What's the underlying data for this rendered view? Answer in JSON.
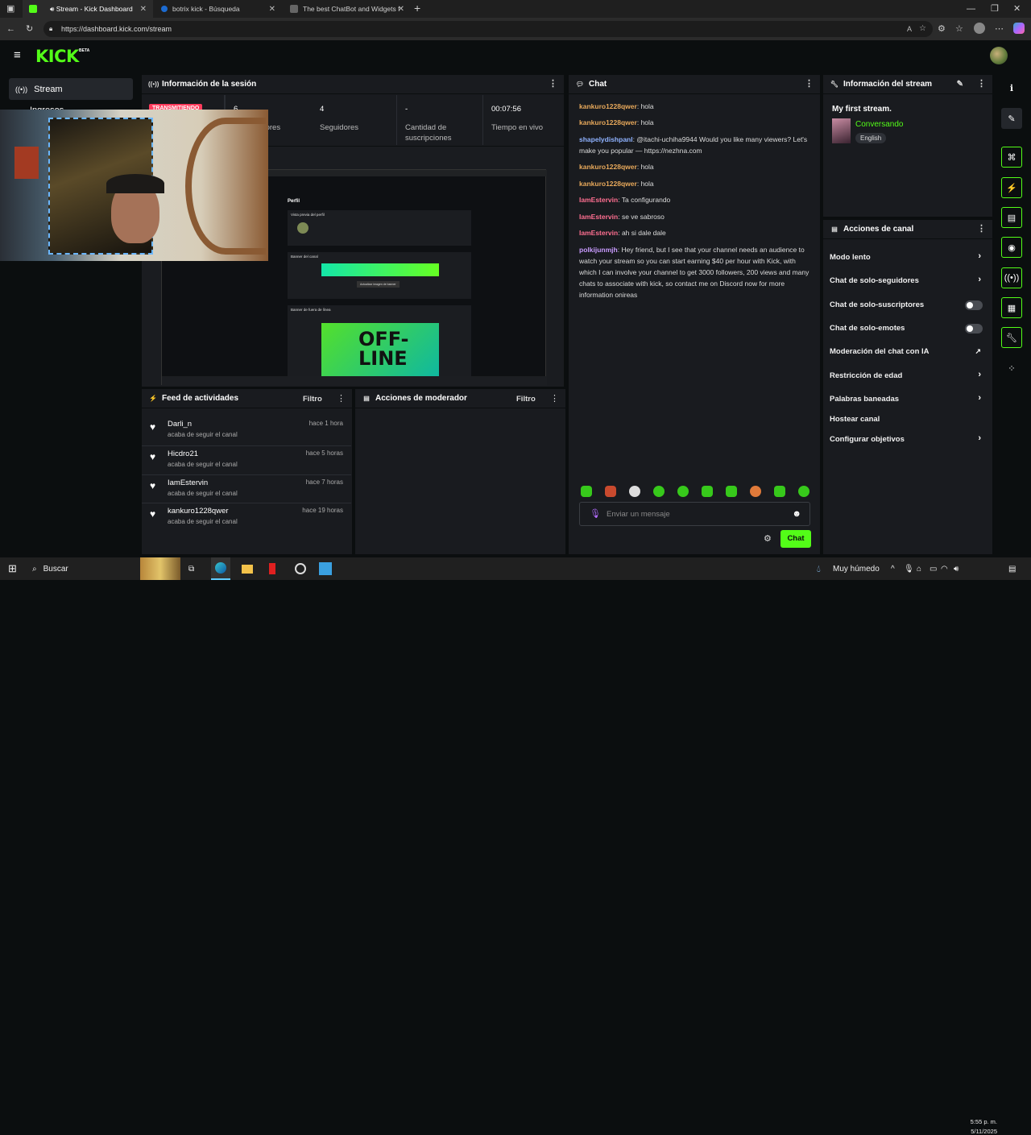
{
  "browser": {
    "tabs": [
      {
        "title": "Stream - Kick Dashboard",
        "active": true
      },
      {
        "title": "botrix kick - Búsqueda",
        "active": false
      },
      {
        "title": "The best ChatBot and Widgets fo",
        "active": false
      }
    ],
    "url": "https://dashboard.kick.com/stream"
  },
  "header": {
    "logo": "KICK",
    "beta": "BETA"
  },
  "nav": {
    "stream_label": "Stream",
    "partial_label": "Ingresos"
  },
  "session": {
    "title": "Información de la sesión",
    "live_badge": "TRANSMITIENDO",
    "stats": [
      {
        "value": "6",
        "label": "Espectadores"
      },
      {
        "value": "4",
        "label": "Seguidores"
      },
      {
        "value": "-",
        "label": "Cantidad de suscripciones"
      },
      {
        "value": "00:07:56",
        "label": "Tiempo en vivo"
      }
    ]
  },
  "preview": {
    "profile_heading": "Perfil",
    "profile_preview": "Vista previa del perfil",
    "banner_label": "Banner del canal",
    "offline_banner_label": "Banner de fuera de línea",
    "offline_text": "OFF- LINE",
    "update_btn": "Actualizar imagen de banner"
  },
  "feed": {
    "title": "Feed de actividades",
    "filter": "Filtro",
    "items": [
      {
        "name": "Darli_n",
        "sub": "acaba de seguir el canal",
        "time": "hace 1 hora"
      },
      {
        "name": "Hicdro21",
        "sub": "acaba de seguir el canal",
        "time": "hace 5 horas"
      },
      {
        "name": "IamEstervin",
        "sub": "acaba de seguir el canal",
        "time": "hace 7 horas"
      },
      {
        "name": "kankuro1228qwer",
        "sub": "acaba de seguir el canal",
        "time": "hace 19 horas"
      }
    ]
  },
  "moderator": {
    "title": "Acciones de moderador",
    "filter": "Filtro"
  },
  "chat": {
    "title": "Chat",
    "messages": [
      {
        "user": "kankuro1228qwer",
        "color": "#e8a95b",
        "text": "hola"
      },
      {
        "user": "kankuro1228qwer",
        "color": "#e8a95b",
        "text": "hola"
      },
      {
        "user": "shapelydishpanl",
        "color": "#8fb2ff",
        "text": "@itachi-uchiha9944 Would you like many viewers? Let's make you popular — https://nezhna.com"
      },
      {
        "user": "kankuro1228qwer",
        "color": "#e8a95b",
        "text": "hola"
      },
      {
        "user": "kankuro1228qwer",
        "color": "#e8a95b",
        "text": "hola"
      },
      {
        "user": "IamEstervin",
        "color": "#ff6f91",
        "text": "Ta configurando"
      },
      {
        "user": "IamEstervin",
        "color": "#ff6f91",
        "text": "se ve sabroso"
      },
      {
        "user": "IamEstervin",
        "color": "#ff6f91",
        "text": "ah si dale dale"
      },
      {
        "user": "polkijunmjh",
        "color": "#c99bff",
        "text": "Hey friend, but I see that your channel needs an audience to watch your stream so you can start earning $40 per hour with Kick, with which I can involve your channel to get 3000 followers, 200 views and many chats to associate with kick, so contact me on Discord now for more information onireas"
      }
    ],
    "input_placeholder": "Enviar un mensaje",
    "send_label": "Chat"
  },
  "stream_info": {
    "title": "Información del stream",
    "stream_title": "My first stream.",
    "category": "Conversando",
    "language": "English"
  },
  "channel_actions": {
    "title": "Acciones de canal",
    "items": [
      {
        "label": "Modo lento",
        "control": "chevron"
      },
      {
        "label": "Chat de solo-seguidores",
        "control": "chevron"
      },
      {
        "label": "Chat de solo-suscriptores",
        "control": "toggle"
      },
      {
        "label": "Chat de solo-emotes",
        "control": "toggle"
      },
      {
        "label": "Moderación del chat con IA",
        "control": "external"
      },
      {
        "label": "Restricción de edad",
        "control": "chevron"
      },
      {
        "label": "Palabras baneadas",
        "control": "chevron"
      },
      {
        "label": "Hostear canal",
        "control": "none"
      },
      {
        "label": "Configurar objetivos",
        "control": "chevron"
      }
    ]
  },
  "taskbar": {
    "search": "Buscar",
    "weather": "Muy húmedo",
    "time": "5:55 p. m.",
    "date": "5/11/2025"
  },
  "colors": {
    "accent": "#53fc18",
    "panel": "#191b1f",
    "bg": "#0b0e0f",
    "live": "#ff3b5c"
  }
}
